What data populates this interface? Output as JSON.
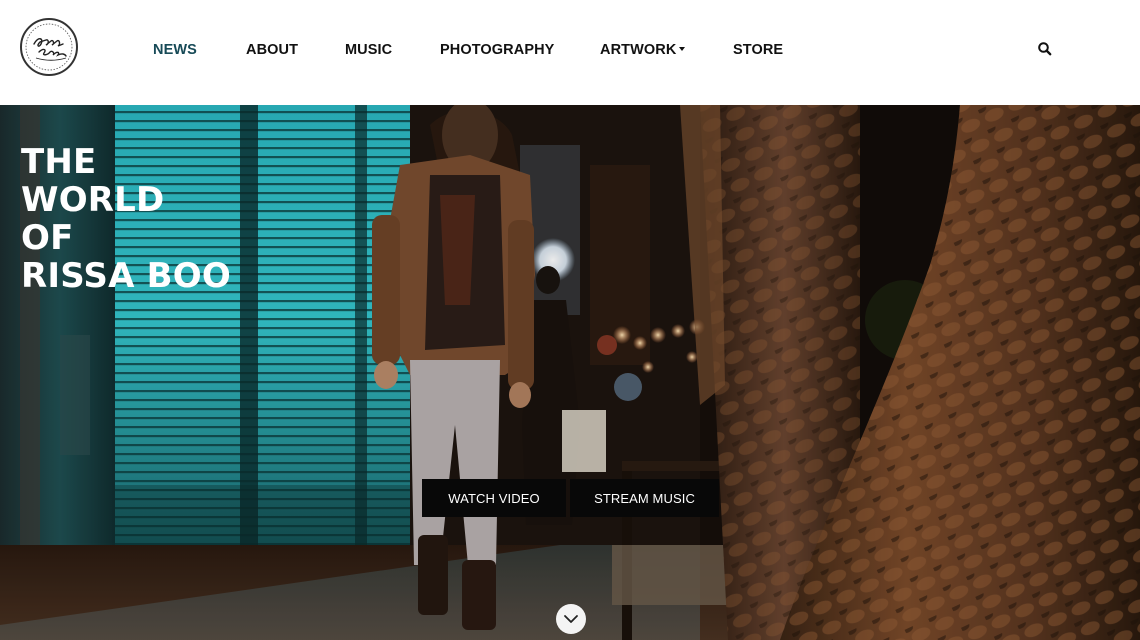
{
  "header": {
    "logo_text": "Rissa Boo",
    "nav": [
      {
        "label": "NEWS",
        "active": true
      },
      {
        "label": "ABOUT",
        "active": false
      },
      {
        "label": "MUSIC",
        "active": false
      },
      {
        "label": "PHOTOGRAPHY",
        "active": false
      },
      {
        "label": "ARTWORK",
        "active": false,
        "has_dropdown": true
      },
      {
        "label": "STORE",
        "active": false
      }
    ],
    "search_icon": "search-icon"
  },
  "hero": {
    "title_lines": [
      "THE",
      "WORLD",
      "OF",
      "RISSA BOO"
    ],
    "buttons": {
      "watch_video": "WATCH VIDEO",
      "stream_music": "STREAM MUSIC"
    },
    "scroll_icon": "chevron-down-icon"
  },
  "colors": {
    "header_bg": "#ffffff",
    "nav_text": "#111111",
    "nav_active": "#174a57",
    "button_bg": "#080808",
    "button_text": "#ffffff",
    "hero_title": "#ffffff"
  }
}
